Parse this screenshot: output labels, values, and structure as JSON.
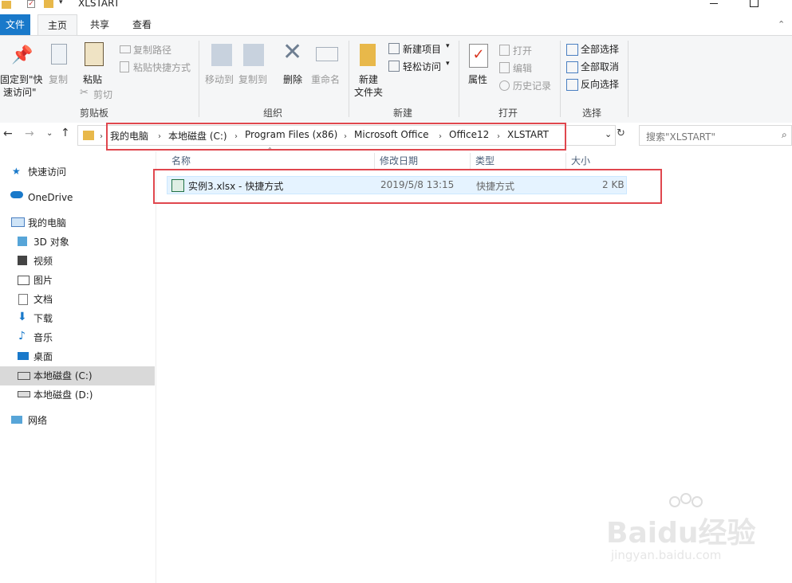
{
  "window": {
    "title": "XLSTART"
  },
  "menu": {
    "file": "文件",
    "home": "主页",
    "share": "共享",
    "view": "查看"
  },
  "ribbon": {
    "pin_line1": "固定到\"快",
    "pin_line2": "速访问\"",
    "copy": "复制",
    "paste": "粘贴",
    "copy_path": "复制路径",
    "paste_shortcut": "粘贴快捷方式",
    "cut": "剪切",
    "clipboard": "剪贴板",
    "move_to": "移动到",
    "copy_to": "复制到",
    "delete": "删除",
    "rename": "重命名",
    "organize": "组织",
    "new_folder_1": "新建",
    "new_folder_2": "文件夹",
    "new_item": "新建项目",
    "easy_access": "轻松访问",
    "new_group": "新建",
    "properties": "属性",
    "open": "打开",
    "edit": "编辑",
    "history": "历史记录",
    "open_group": "打开",
    "select_all": "全部选择",
    "select_none": "全部取消",
    "invert_selection": "反向选择",
    "select_group": "选择"
  },
  "address": {
    "crumbs": [
      "我的电脑",
      "本地磁盘 (C:)",
      "Program Files (x86)",
      "Microsoft Office",
      "Office12",
      "XLSTART"
    ],
    "search_placeholder": "搜索\"XLSTART\""
  },
  "sidebar": {
    "quick_access": "快速访问",
    "onedrive": "OneDrive",
    "this_pc": "我的电脑",
    "objects3d": "3D 对象",
    "videos": "视频",
    "pictures": "图片",
    "documents": "文档",
    "downloads": "下载",
    "music": "音乐",
    "desktop": "桌面",
    "drive_c": "本地磁盘 (C:)",
    "drive_d": "本地磁盘 (D:)",
    "network": "网络"
  },
  "columns": {
    "name": "名称",
    "modified": "修改日期",
    "type": "类型",
    "size": "大小"
  },
  "files": [
    {
      "name": "实例3.xlsx - 快捷方式",
      "modified": "2019/5/8 13:15",
      "type": "快捷方式",
      "size": "2 KB"
    }
  ],
  "watermark": {
    "brand": "Baidu经验",
    "url": "jingyan.baidu.com"
  },
  "colors": {
    "accent": "#1979ca",
    "highlight_box": "#e0474e",
    "selected_nav": "#cce8ff"
  }
}
